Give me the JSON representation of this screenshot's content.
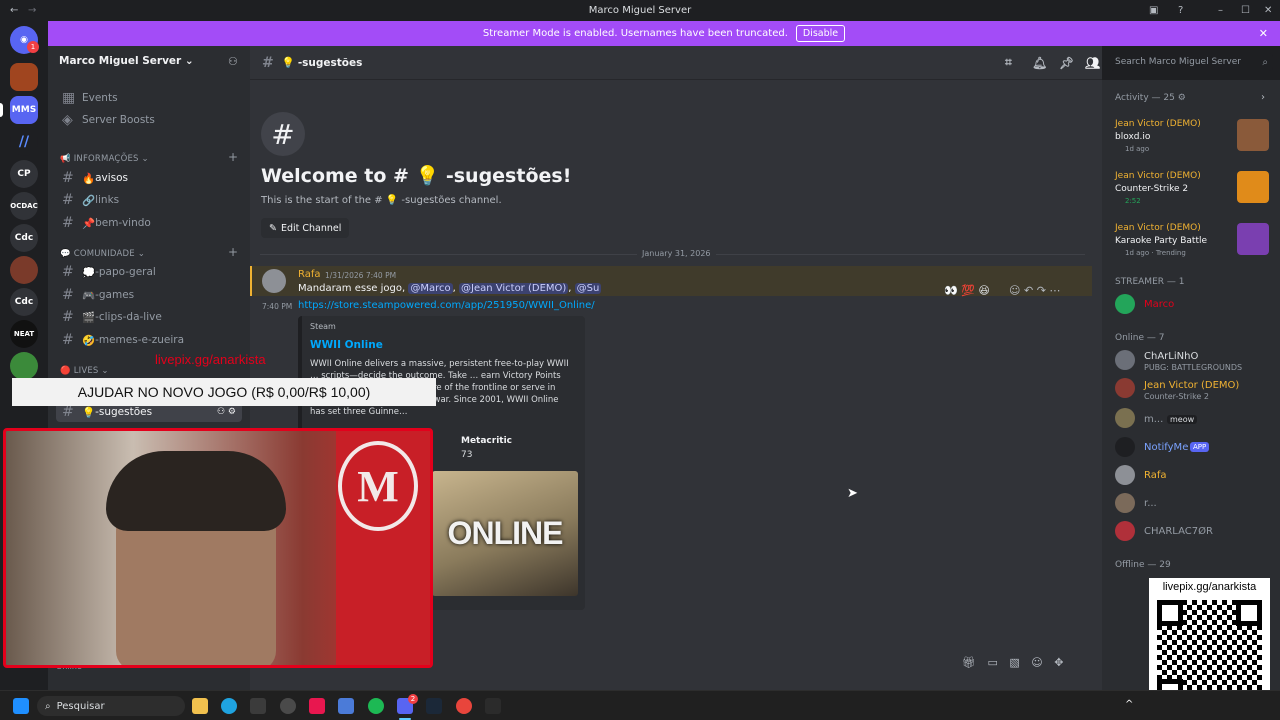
{
  "window": {
    "title": "Marco Miguel Server"
  },
  "banner": {
    "text": "Streamer Mode is enabled. Usernames have been truncated.",
    "button": "Disable"
  },
  "servers": [
    {
      "label": ""
    },
    {
      "label": ""
    },
    {
      "label": "MMS"
    },
    {
      "label": ""
    },
    {
      "label": "CP"
    },
    {
      "label": "OCDAC"
    },
    {
      "label": "Cdc"
    },
    {
      "label": ""
    },
    {
      "label": "Cdc"
    },
    {
      "label": "NEAT"
    },
    {
      "label": ""
    }
  ],
  "notification_badge": "1",
  "sidebar": {
    "server_name": "Marco Miguel Server",
    "top_items": [
      "Events",
      "Server Boosts"
    ],
    "categories": [
      {
        "name": "INFORMAÇÕES",
        "channels": [
          "avisos",
          "links",
          "bem-vindo"
        ]
      },
      {
        "name": "COMUNIDADE",
        "channels": [
          "-papo-geral",
          "-games",
          "-clips-da-live",
          "-memes-e-zueira"
        ]
      },
      {
        "name": "LIVES",
        "channels": []
      }
    ],
    "active_channel": "-sugestões"
  },
  "channel_header": {
    "name": "-sugestões"
  },
  "search": {
    "placeholder": "Search Marco Miguel Server"
  },
  "welcome": {
    "title": "Welcome to # 💡 -sugestões!",
    "subtitle": "This is the start of the # 💡 -sugestões channel.",
    "edit_button": "Edit Channel"
  },
  "date_divider": "January 31, 2026",
  "message": {
    "author": "Rafa",
    "timestamp": "1/31/2026 7:40 PM",
    "text_prefix": "Mandaram esse jogo,",
    "mentions": [
      "@Marco",
      "@Jean Victor (DEMO)",
      "@Su"
    ],
    "side_time": "7:40 PM",
    "link": "https://store.steampowered.com/app/251950/WWII_Online/",
    "embed": {
      "provider": "Steam",
      "title": "WWII Online",
      "description": "WWII Online delivers a massive, persistent free-to-play WWII … scripts—decide the outcome. Take … earn Victory Points and rank to … to form the core of the frontline or serve in High Command to direct the war. Since 2001, WWII Online has set three Guinne…",
      "field_name": "Metacritic",
      "field_value": "73",
      "image_text": "ONLINE"
    }
  },
  "members": {
    "activity_header": "Activity — 25",
    "activity": [
      {
        "user": "Jean Victor (DEMO)",
        "game": "bloxd.io",
        "meta": "1d ago"
      },
      {
        "user": "Jean Victor (DEMO)",
        "game": "Counter-Strike 2",
        "meta": "2:52"
      },
      {
        "user": "Jean Victor (DEMO)",
        "game": "Karaoke Party Battle",
        "meta": "1d ago · Trending"
      }
    ],
    "streamer_header": "STREAMER — 1",
    "streamer": [
      {
        "name": "Marco"
      }
    ],
    "online_header": "Online — 7",
    "online": [
      {
        "name": "ChArLiNhO",
        "sub": "PUBG: BATTLEGROUNDS"
      },
      {
        "name": "Jean Victor (DEMO)",
        "sub": "Counter-Strike 2"
      },
      {
        "name": "m...",
        "sub": "meow"
      },
      {
        "name": "NotifyMe",
        "sub": "",
        "badge": "APP"
      },
      {
        "name": "Rafa",
        "sub": ""
      },
      {
        "name": "r...",
        "sub": ""
      },
      {
        "name": "CHARLAC7ØR",
        "sub": ""
      }
    ],
    "offline_header": "Offline — 29"
  },
  "overlay": {
    "pix_text": "livepix.gg/anarkista",
    "goal_text": "AJUDAR NO NOVO JOGO (R$ 0,00/R$ 10,00)",
    "qr_label": "livepix.gg/anarkista"
  },
  "user_status": "Online",
  "taskbar": {
    "search": "Pesquisar",
    "discord_badge": "2"
  },
  "colors": {
    "accent": "#5865f2",
    "banner": "#a34cf7",
    "mention_bg": "#3c4270",
    "gold": "#f0b232",
    "red": "#e3001b"
  }
}
